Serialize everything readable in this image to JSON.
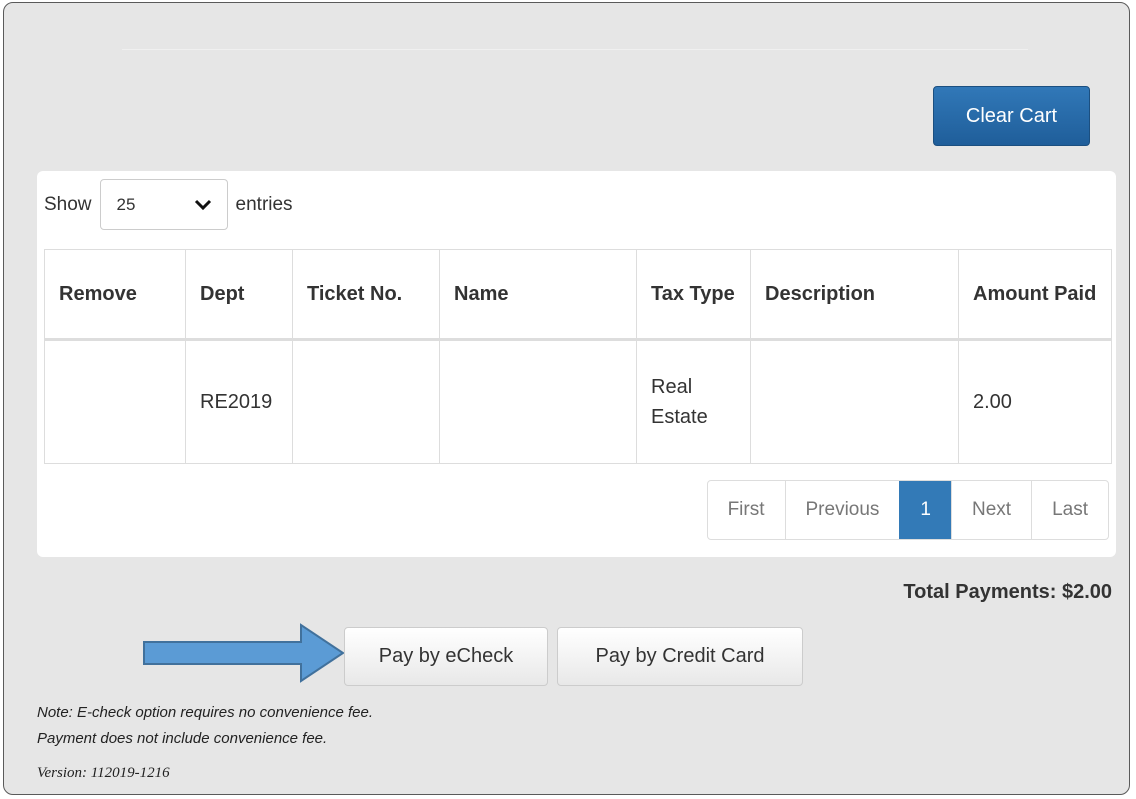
{
  "header": {
    "clear_cart_label": "Clear Cart"
  },
  "length_menu": {
    "show_label": "Show",
    "selected": "25",
    "entries_label": "entries"
  },
  "table": {
    "columns": [
      "Remove",
      "Dept",
      "Ticket No.",
      "Name",
      "Tax Type",
      "Description",
      "Amount Paid"
    ],
    "rows": [
      {
        "remove": "",
        "dept": "RE2019",
        "ticket": "",
        "name": "",
        "tax_type": "Real Estate",
        "description": "",
        "amount": "2.00"
      }
    ]
  },
  "pagination": {
    "first": "First",
    "previous": "Previous",
    "current": "1",
    "next": "Next",
    "last": "Last"
  },
  "total_payments": "Total Payments: $2.00",
  "buttons": {
    "echeck": "Pay by eCheck",
    "credit_card": "Pay by Credit Card"
  },
  "notes": {
    "line1": "Note: E-check option requires no convenience fee.",
    "line2": "Payment does not include convenience fee.",
    "version": "Version: 112019-1216"
  },
  "colors": {
    "primary": "#337ab7",
    "arrow_fill": "#5b9bd5",
    "arrow_stroke": "#41719c"
  },
  "icons": {
    "select_caret": "chevron-down-icon",
    "pointer": "right-arrow-icon"
  }
}
